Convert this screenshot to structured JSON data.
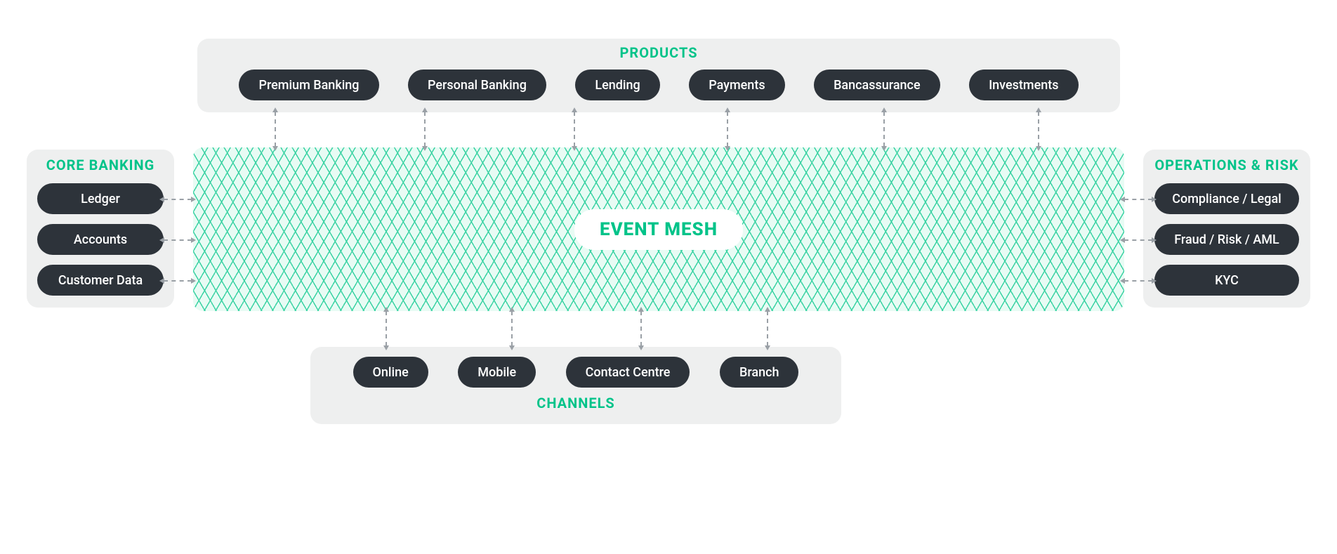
{
  "center": {
    "label": "EVENT MESH"
  },
  "products": {
    "title": "PRODUCTS",
    "items": [
      "Premium Banking",
      "Personal Banking",
      "Lending",
      "Payments",
      "Bancassurance",
      "Investments"
    ]
  },
  "channels": {
    "title": "CHANNELS",
    "items": [
      "Online",
      "Mobile",
      "Contact Centre",
      "Branch"
    ]
  },
  "core_banking": {
    "title": "CORE BANKING",
    "items": [
      "Ledger",
      "Accounts",
      "Customer Data"
    ]
  },
  "operations_risk": {
    "title": "OPERATIONS & RISK",
    "items": [
      "Compliance / Legal",
      "Fraud / Risk / AML",
      "KYC"
    ]
  }
}
